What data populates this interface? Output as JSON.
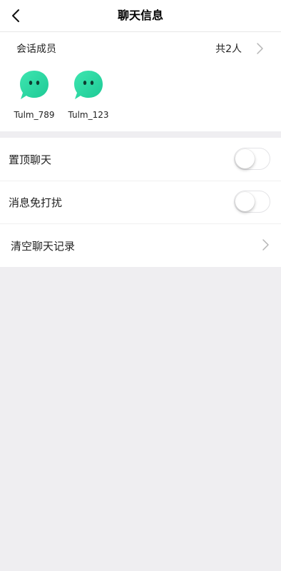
{
  "header": {
    "title": "聊天信息",
    "back_icon": "back-arrow-icon"
  },
  "members": {
    "title": "会话成员",
    "count_label": "共2人",
    "avatar_color": "#2bd9a3",
    "list": [
      {
        "name": "Tulm_789"
      },
      {
        "name": "Tulm_123"
      }
    ]
  },
  "settings": {
    "pin_chat": {
      "label": "置顶聊天",
      "on": false
    },
    "mute": {
      "label": "消息免打扰",
      "on": false
    },
    "clear_history": {
      "label": "清空聊天记录"
    }
  }
}
